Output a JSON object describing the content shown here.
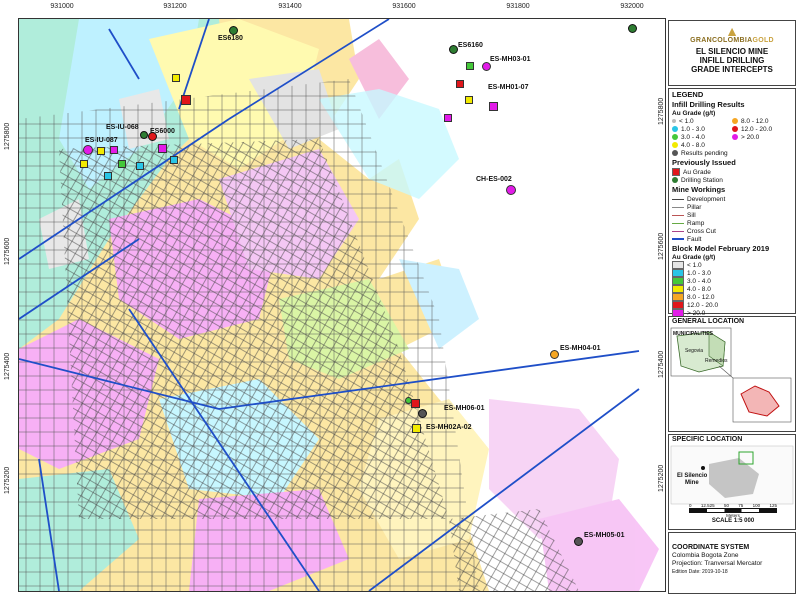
{
  "logo": {
    "text_gran": "GRAN",
    "text_colombia": "COLOMBIA",
    "text_gold": "GOLD"
  },
  "title": {
    "line1": "EL SILENCIO MINE",
    "line2": "INFILL DRILLING",
    "line3": "GRADE INTERCEPTS"
  },
  "legend": {
    "heading": "LEGEND",
    "infill_title": "Infill Drilling Results",
    "au_grade": "Au Grade (g/t)",
    "grades_left": [
      "< 1.0",
      "1.0 - 3.0",
      "3.0 - 4.0",
      "4.0 - 8.0"
    ],
    "grades_right": [
      "8.0 - 12.0",
      "12.0 - 20.0",
      "> 20.0"
    ],
    "results_pending": "Results pending",
    "prev_title": "Previously Issued",
    "prev_au": "Au Grade",
    "prev_station": "Drilling Station",
    "workings_title": "Mine Workings",
    "workings": [
      "Development",
      "Pillar",
      "Sill",
      "Ramp",
      "Cross Cut",
      "Fault"
    ],
    "block_title": "Block Model February 2019",
    "block_sub": "Au Grade (g/t)",
    "block_items": [
      "< 1.0",
      "1.0 - 3.0",
      "3.0 - 4.0",
      "4.0 - 8.0",
      "8.0 - 12.0",
      "12.0 - 20.0",
      "> 20.0"
    ]
  },
  "general_location": {
    "title": "GENERAL LOCATION",
    "municipalities": "MUNICIPALITIES",
    "segovia": "Segovia",
    "remedios": "Remedios"
  },
  "specific_location": {
    "title": "SPECIFIC LOCATION",
    "mine_label_1": "El Silencio",
    "mine_label_2": "Mine"
  },
  "scale": {
    "ticks": [
      "0",
      "12.525",
      "50",
      "75",
      "100",
      "125"
    ],
    "unit": "Meters",
    "text": "SCALE 1:5 000"
  },
  "coordinate": {
    "title": "COORDINATE SYSTEM",
    "line1": "Colombia Bogota Zone",
    "line2": "Projection: Tranversal Mercator",
    "edition": "Edition Date: 2019-10-18"
  },
  "axes": {
    "x_ticks": [
      "931000",
      "931200",
      "931400",
      "931600",
      "931800",
      "932000"
    ],
    "y_ticks": [
      "1275800",
      "1275600",
      "1275400",
      "1275200"
    ]
  },
  "labels": {
    "es6180": "ES6180",
    "es6160": "ES6160",
    "mh03": "ES-MH03-01",
    "mh01": "ES-MH01-07",
    "iu068": "ES-IU-068",
    "es6000": "ES6000",
    "iu087": "ES-IU-087",
    "ches002": "CH-ES-002",
    "mh04": "ES-MH04-01",
    "mh06": "ES-MH06-01",
    "mh02a": "ES-MH02A-02",
    "mh05": "ES-MH05-01"
  },
  "colors": {
    "cyan": "#29c5e6",
    "green": "#44c83a",
    "yellow": "#f2ea00",
    "orange": "#f5a623",
    "red": "#e0161b",
    "magenta": "#e21be8",
    "light": "#e6e6e6",
    "fault": "#1f4fc8"
  }
}
